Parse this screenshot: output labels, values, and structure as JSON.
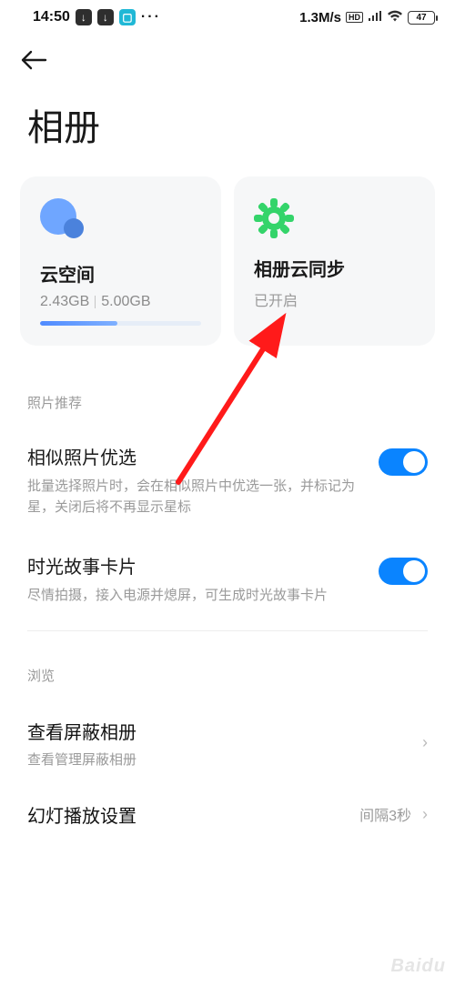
{
  "statusbar": {
    "time": "14:50",
    "net_rate": "1.3M/s",
    "hd": "HD",
    "battery_pct": "47"
  },
  "page": {
    "title": "相册"
  },
  "cards": {
    "cloud": {
      "title": "云空间",
      "used": "2.43GB",
      "total": "5.00GB"
    },
    "sync": {
      "title": "相册云同步",
      "status": "已开启"
    }
  },
  "sections": {
    "recommend_label": "照片推荐",
    "browse_label": "浏览"
  },
  "settings": {
    "similar": {
      "title": "相似照片优选",
      "desc": "批量选择照片时，会在相似照片中优选一张，并标记为星，关闭后将不再显示星标"
    },
    "story": {
      "title": "时光故事卡片",
      "desc": "尽情拍摄，接入电源并熄屏，可生成时光故事卡片"
    },
    "hidden": {
      "title": "查看屏蔽相册",
      "desc": "查看管理屏蔽相册"
    },
    "slideshow": {
      "title": "幻灯播放设置",
      "value": "间隔3秒"
    }
  },
  "watermark": "Baidu"
}
